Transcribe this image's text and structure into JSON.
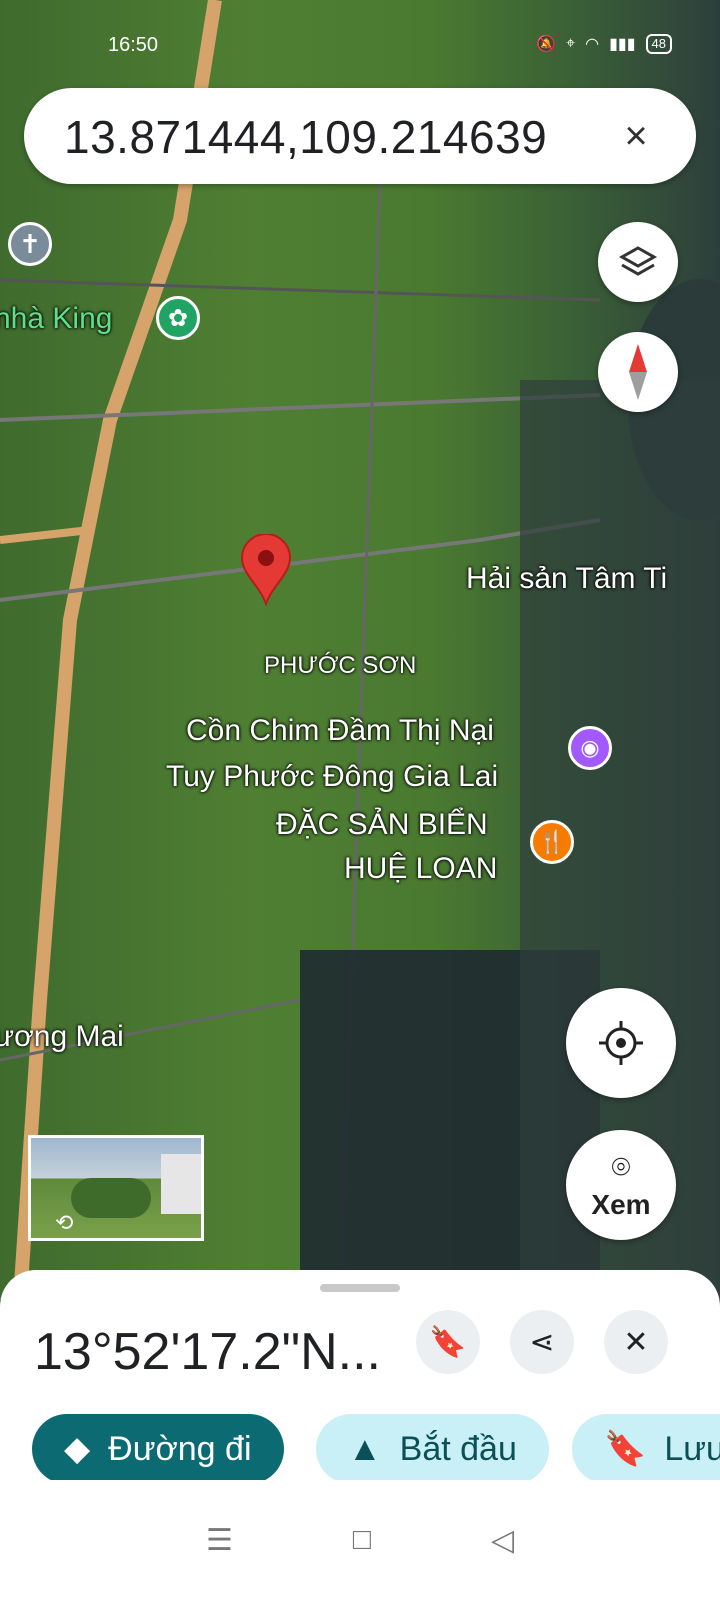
{
  "status": {
    "time": "16:50",
    "battery": "48"
  },
  "search": {
    "query": "13.871444,109.214639",
    "close_icon": "×"
  },
  "map": {
    "labels": {
      "nha_king": "nhà King",
      "hai_san": "Hải sản Tâm Ti",
      "phuoc_son": "PHƯỚC SƠN",
      "con_chim_1": "Cồn Chim Đầm Thị Nại",
      "con_chim_2": "Tuy Phước Đông Gia Lai",
      "dac_san_1": "ĐẶC SẢN BIỂN",
      "dac_san_2": "HUỆ LOAN",
      "uong_mai": "ương Mai"
    },
    "icons": {
      "layers": "layers-icon",
      "compass": "compass-icon",
      "location": "my-location-icon",
      "pin": "location-pin-icon"
    }
  },
  "streetview": {
    "label": "Xem"
  },
  "sheet": {
    "coordinates": "13°52'17.2\"N...",
    "chips": {
      "directions": "Đường đi",
      "start": "Bắt đầu",
      "save": "Lưu"
    }
  },
  "colors": {
    "primary": "#0b6a72",
    "secondary_chip": "#c9f0f6",
    "pin": "#e53935"
  }
}
